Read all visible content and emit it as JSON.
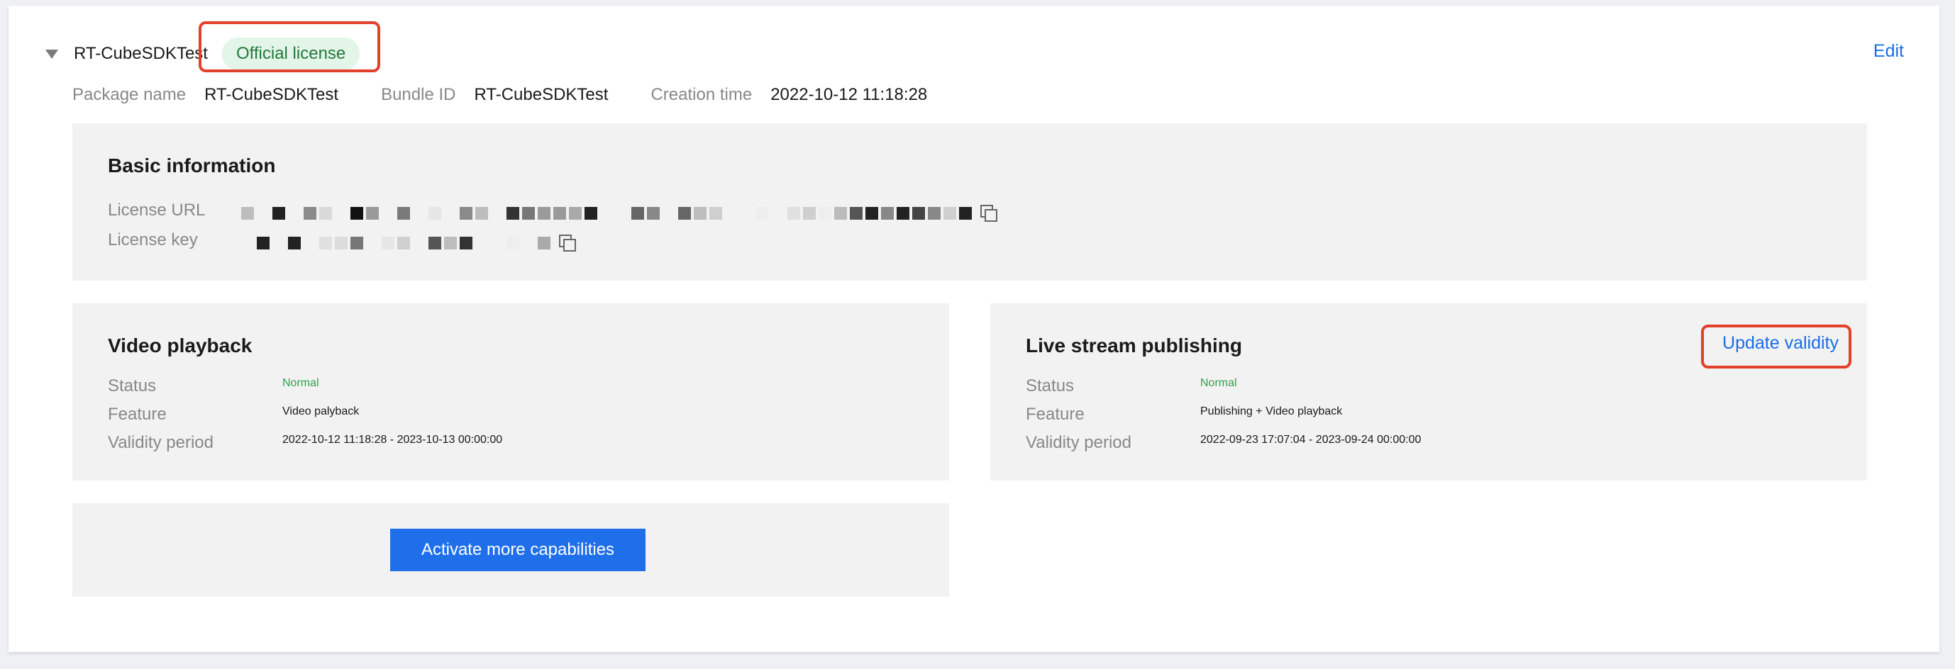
{
  "app": {
    "name": "RT-CubeSDKTest",
    "badge": "Official license",
    "edit_label": "Edit"
  },
  "meta": [
    {
      "label": "Package name",
      "value": "RT-CubeSDKTest"
    },
    {
      "label": "Bundle ID",
      "value": "RT-CubeSDKTest"
    },
    {
      "label": "Creation time",
      "value": "2022-10-12 11:18:28"
    }
  ],
  "basic": {
    "title": "Basic information",
    "license_url_label": "License URL",
    "license_key_label": "License key"
  },
  "video": {
    "title": "Video playback",
    "status_label": "Status",
    "status_value": "Normal",
    "feature_label": "Feature",
    "feature_value": "Video palyback",
    "validity_label": "Validity period",
    "validity_value": "2022-10-12 11:18:28 - 2023-10-13 00:00:00"
  },
  "live": {
    "title": "Live stream publishing",
    "update_label": "Update validity",
    "status_label": "Status",
    "status_value": "Normal",
    "feature_label": "Feature",
    "feature_value": "Publishing + Video playback",
    "validity_label": "Validity period",
    "validity_value": "2022-09-23 17:07:04 - 2023-09-24 00:00:00"
  },
  "activate": {
    "button_label": "Activate more capabilities"
  },
  "colors": {
    "accent": "#1a6de8",
    "status_ok": "#2ea44f",
    "badge_bg": "#e3f4e8",
    "highlight": "#e3402c"
  },
  "icons": {
    "expand": "caret-down-icon",
    "copy": "copy-icon"
  }
}
